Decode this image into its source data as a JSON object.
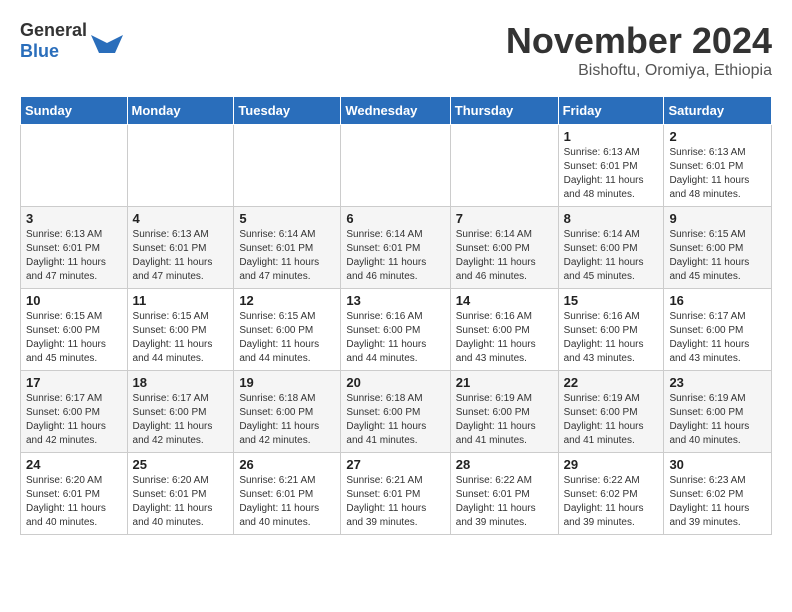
{
  "logo": {
    "text_general": "General",
    "text_blue": "Blue"
  },
  "header": {
    "month_title": "November 2024",
    "subtitle": "Bishoftu, Oromiya, Ethiopia"
  },
  "days_of_week": [
    "Sunday",
    "Monday",
    "Tuesday",
    "Wednesday",
    "Thursday",
    "Friday",
    "Saturday"
  ],
  "weeks": [
    [
      {
        "day": "",
        "info": ""
      },
      {
        "day": "",
        "info": ""
      },
      {
        "day": "",
        "info": ""
      },
      {
        "day": "",
        "info": ""
      },
      {
        "day": "",
        "info": ""
      },
      {
        "day": "1",
        "info": "Sunrise: 6:13 AM\nSunset: 6:01 PM\nDaylight: 11 hours and 48 minutes."
      },
      {
        "day": "2",
        "info": "Sunrise: 6:13 AM\nSunset: 6:01 PM\nDaylight: 11 hours and 48 minutes."
      }
    ],
    [
      {
        "day": "3",
        "info": "Sunrise: 6:13 AM\nSunset: 6:01 PM\nDaylight: 11 hours and 47 minutes."
      },
      {
        "day": "4",
        "info": "Sunrise: 6:13 AM\nSunset: 6:01 PM\nDaylight: 11 hours and 47 minutes."
      },
      {
        "day": "5",
        "info": "Sunrise: 6:14 AM\nSunset: 6:01 PM\nDaylight: 11 hours and 47 minutes."
      },
      {
        "day": "6",
        "info": "Sunrise: 6:14 AM\nSunset: 6:01 PM\nDaylight: 11 hours and 46 minutes."
      },
      {
        "day": "7",
        "info": "Sunrise: 6:14 AM\nSunset: 6:00 PM\nDaylight: 11 hours and 46 minutes."
      },
      {
        "day": "8",
        "info": "Sunrise: 6:14 AM\nSunset: 6:00 PM\nDaylight: 11 hours and 45 minutes."
      },
      {
        "day": "9",
        "info": "Sunrise: 6:15 AM\nSunset: 6:00 PM\nDaylight: 11 hours and 45 minutes."
      }
    ],
    [
      {
        "day": "10",
        "info": "Sunrise: 6:15 AM\nSunset: 6:00 PM\nDaylight: 11 hours and 45 minutes."
      },
      {
        "day": "11",
        "info": "Sunrise: 6:15 AM\nSunset: 6:00 PM\nDaylight: 11 hours and 44 minutes."
      },
      {
        "day": "12",
        "info": "Sunrise: 6:15 AM\nSunset: 6:00 PM\nDaylight: 11 hours and 44 minutes."
      },
      {
        "day": "13",
        "info": "Sunrise: 6:16 AM\nSunset: 6:00 PM\nDaylight: 11 hours and 44 minutes."
      },
      {
        "day": "14",
        "info": "Sunrise: 6:16 AM\nSunset: 6:00 PM\nDaylight: 11 hours and 43 minutes."
      },
      {
        "day": "15",
        "info": "Sunrise: 6:16 AM\nSunset: 6:00 PM\nDaylight: 11 hours and 43 minutes."
      },
      {
        "day": "16",
        "info": "Sunrise: 6:17 AM\nSunset: 6:00 PM\nDaylight: 11 hours and 43 minutes."
      }
    ],
    [
      {
        "day": "17",
        "info": "Sunrise: 6:17 AM\nSunset: 6:00 PM\nDaylight: 11 hours and 42 minutes."
      },
      {
        "day": "18",
        "info": "Sunrise: 6:17 AM\nSunset: 6:00 PM\nDaylight: 11 hours and 42 minutes."
      },
      {
        "day": "19",
        "info": "Sunrise: 6:18 AM\nSunset: 6:00 PM\nDaylight: 11 hours and 42 minutes."
      },
      {
        "day": "20",
        "info": "Sunrise: 6:18 AM\nSunset: 6:00 PM\nDaylight: 11 hours and 41 minutes."
      },
      {
        "day": "21",
        "info": "Sunrise: 6:19 AM\nSunset: 6:00 PM\nDaylight: 11 hours and 41 minutes."
      },
      {
        "day": "22",
        "info": "Sunrise: 6:19 AM\nSunset: 6:00 PM\nDaylight: 11 hours and 41 minutes."
      },
      {
        "day": "23",
        "info": "Sunrise: 6:19 AM\nSunset: 6:00 PM\nDaylight: 11 hours and 40 minutes."
      }
    ],
    [
      {
        "day": "24",
        "info": "Sunrise: 6:20 AM\nSunset: 6:01 PM\nDaylight: 11 hours and 40 minutes."
      },
      {
        "day": "25",
        "info": "Sunrise: 6:20 AM\nSunset: 6:01 PM\nDaylight: 11 hours and 40 minutes."
      },
      {
        "day": "26",
        "info": "Sunrise: 6:21 AM\nSunset: 6:01 PM\nDaylight: 11 hours and 40 minutes."
      },
      {
        "day": "27",
        "info": "Sunrise: 6:21 AM\nSunset: 6:01 PM\nDaylight: 11 hours and 39 minutes."
      },
      {
        "day": "28",
        "info": "Sunrise: 6:22 AM\nSunset: 6:01 PM\nDaylight: 11 hours and 39 minutes."
      },
      {
        "day": "29",
        "info": "Sunrise: 6:22 AM\nSunset: 6:02 PM\nDaylight: 11 hours and 39 minutes."
      },
      {
        "day": "30",
        "info": "Sunrise: 6:23 AM\nSunset: 6:02 PM\nDaylight: 11 hours and 39 minutes."
      }
    ]
  ]
}
